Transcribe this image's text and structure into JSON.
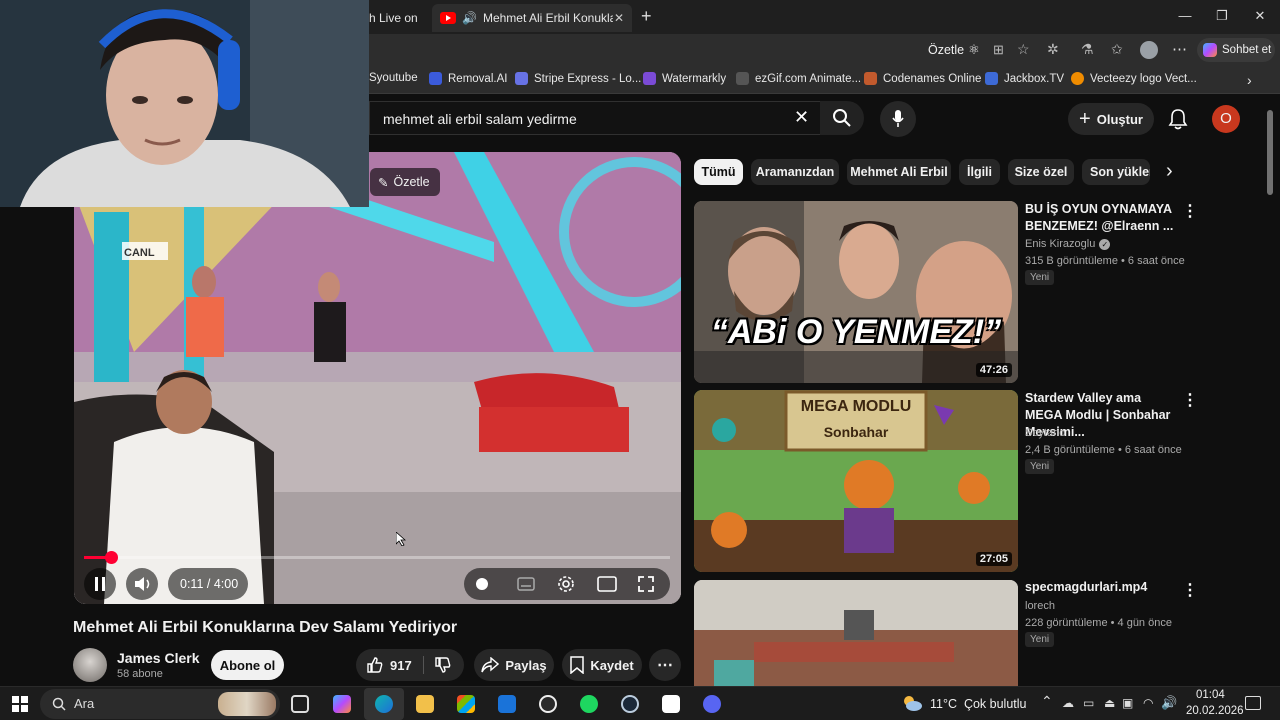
{
  "browser": {
    "tabs": [
      {
        "label": "h Live on"
      },
      {
        "label": "Mehmet Ali Erbil Konuklarına"
      }
    ],
    "address": {
      "summarize": "Özetle",
      "chat": "Sohbet et"
    },
    "bookmarks": [
      {
        "label": "Syoutube",
        "color": "#444"
      },
      {
        "label": "Removal.AI",
        "color": "#3b5bdb"
      },
      {
        "label": "Stripe Express - Lo...",
        "color": "#6772e5"
      },
      {
        "label": "Watermarkly",
        "color": "#7b4bd6"
      },
      {
        "label": "ezGif.com Animate...",
        "color": "#555"
      },
      {
        "label": "Codenames Online",
        "color": "#c25a2d"
      },
      {
        "label": "Jackbox.TV",
        "color": "#3d6ad6"
      },
      {
        "label": "Vecteezy logo Vect...",
        "color": "#f08c00"
      }
    ]
  },
  "youtube": {
    "search_query": "mehmet ali erbil salam yedirme",
    "create_label": "Oluştur",
    "avatar_letter": "O",
    "player": {
      "summarize_label": "Özetle",
      "time": "0:11 / 4:00",
      "progress": 0.046,
      "logo_text": "CANL"
    },
    "video": {
      "title": "Mehmet Ali Erbil Konuklarına Dev Salamı Yediriyor",
      "channel": "James Clerk",
      "subscribers": "58 abone",
      "subscribe_label": "Abone ol",
      "likes": "917",
      "share_label": "Paylaş",
      "save_label": "Kaydet"
    },
    "chips": [
      "Tümü",
      "Aramanızdan",
      "Mehmet Ali Erbil",
      "İlgili",
      "Size özel",
      "Son yüklen"
    ],
    "related": [
      {
        "title": "BU İŞ OYUN OYNAMAYA BENZEMEZ! @Elraenn ...",
        "channel": "Enis Kirazoglu",
        "meta": "315 B görüntüleme • 6 saat önce",
        "badge": "Yeni",
        "duration": "47:26",
        "thumb_text": "“ABi O YENMEZ!”"
      },
      {
        "title": "Stardew Valley ama MEGA Modlu | Sonbahar Mevsimi...",
        "channel": "Soytario",
        "meta": "2,4 B görüntüleme • 6 saat önce",
        "badge": "Yeni",
        "duration": "27:05",
        "thumb_text_1": "MEGA MODLU",
        "thumb_text_2": "Sonbahar"
      },
      {
        "title": "specmagdurlari.mp4",
        "channel": "lorech",
        "meta": "228 görüntüleme • 4 gün önce",
        "badge": "Yeni"
      }
    ]
  },
  "taskbar": {
    "search_label": "Ara",
    "weather": "11°C  Çok bulutlu",
    "time": "01:04",
    "date": "20.02.2026"
  }
}
